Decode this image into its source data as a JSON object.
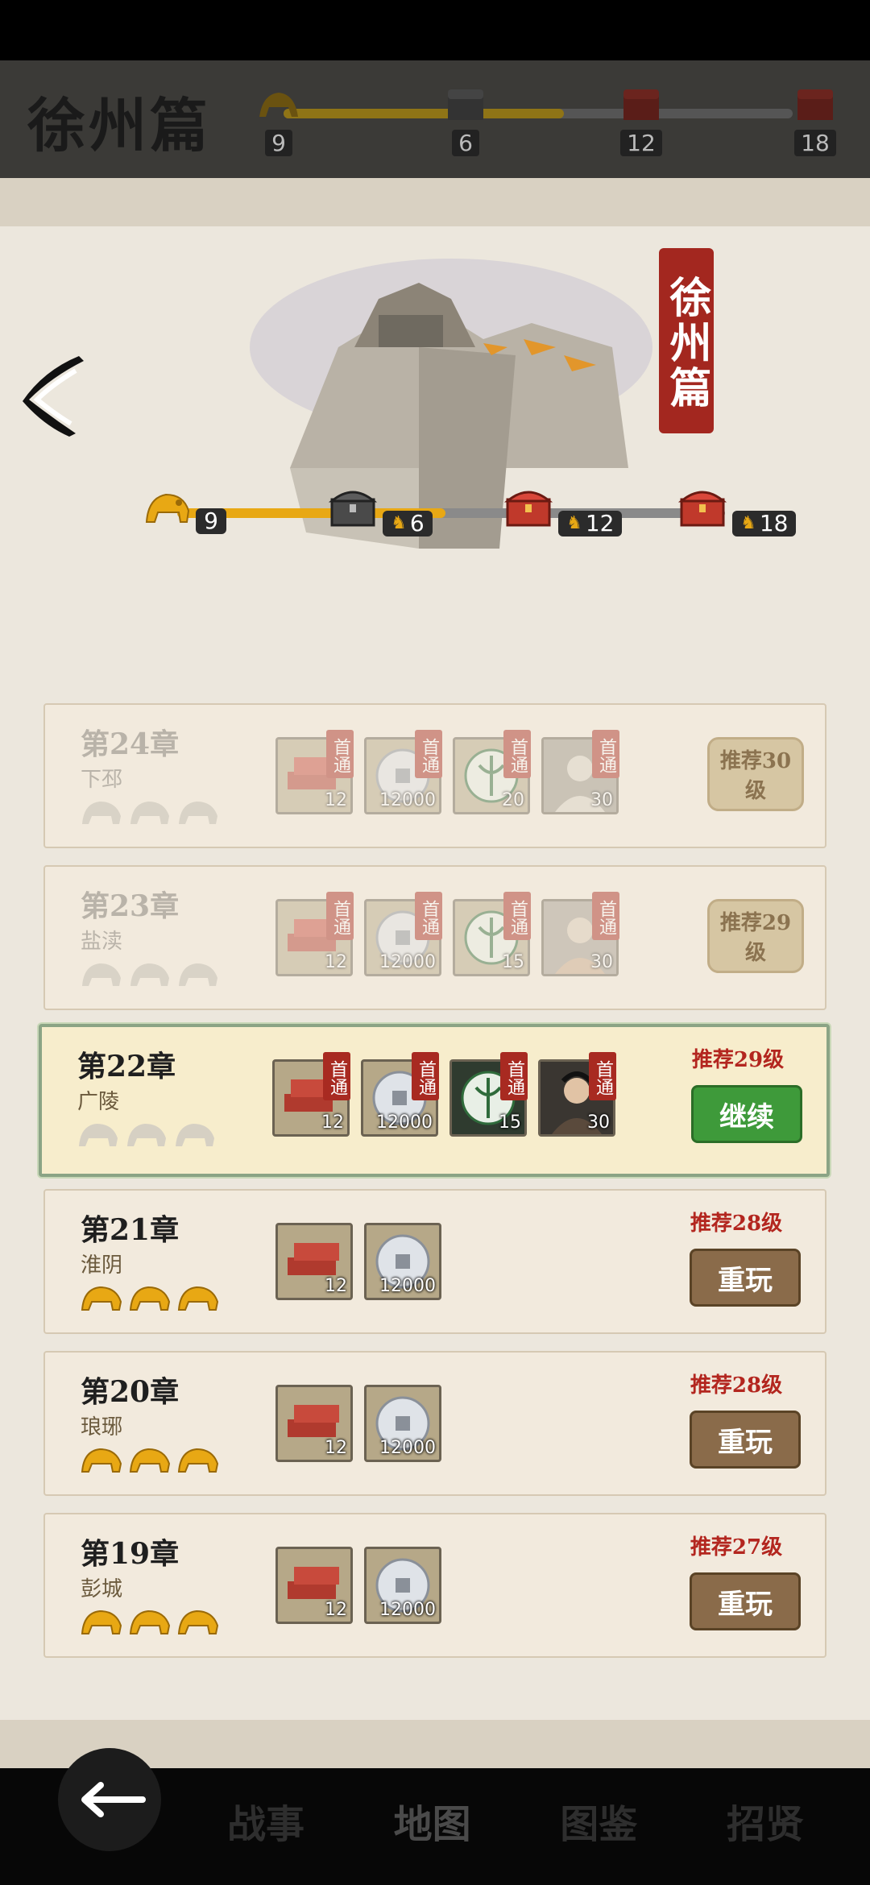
{
  "top_banner": {
    "title": "徐州篇",
    "nodes": [
      {
        "value": "9",
        "icon": "beast-icon"
      },
      {
        "value": "6",
        "icon": "chest-icon"
      },
      {
        "value": "12",
        "icon": "chest-icon"
      },
      {
        "value": "18",
        "icon": "chest-icon"
      }
    ]
  },
  "header": {
    "seal_text": "徐州篇",
    "back_icon": "chevron-left-icon",
    "progress": {
      "fraction": 0.49,
      "milestones": [
        {
          "value": "9",
          "icon": "beast-icon"
        },
        {
          "value": "6",
          "icon": "iron-chest-icon"
        },
        {
          "value": "12",
          "icon": "red-chest-icon"
        },
        {
          "value": "18",
          "icon": "red-chest-icon"
        }
      ]
    }
  },
  "chapters": [
    {
      "title": "第24章",
      "place": "下邳",
      "state": "locked",
      "stars": 0,
      "rewards": [
        {
          "type": "brick",
          "amount": "12",
          "tag": "首通"
        },
        {
          "type": "coin",
          "amount": "12000",
          "tag": "首通"
        },
        {
          "type": "token",
          "amount": "20",
          "tag": "首通"
        },
        {
          "type": "hero",
          "amount": "30",
          "tag": "首通"
        }
      ],
      "lock_label": "推荐30级"
    },
    {
      "title": "第23章",
      "place": "盐渎",
      "state": "locked",
      "stars": 0,
      "rewards": [
        {
          "type": "brick",
          "amount": "12",
          "tag": "首通"
        },
        {
          "type": "coin",
          "amount": "12000",
          "tag": "首通"
        },
        {
          "type": "token",
          "amount": "15",
          "tag": "首通"
        },
        {
          "type": "hero",
          "amount": "30",
          "tag": "首通"
        }
      ],
      "lock_label": "推荐29级"
    },
    {
      "title": "第22章",
      "place": "广陵",
      "state": "active",
      "stars": 0,
      "rewards": [
        {
          "type": "brick",
          "amount": "12",
          "tag": "首通"
        },
        {
          "type": "coin",
          "amount": "12000",
          "tag": "首通"
        },
        {
          "type": "token",
          "amount": "15",
          "tag": "首通"
        },
        {
          "type": "hero",
          "amount": "30",
          "tag": "首通"
        }
      ],
      "recommend": "推荐29级",
      "button": "继续"
    },
    {
      "title": "第21章",
      "place": "淮阴",
      "state": "done",
      "stars": 3,
      "rewards": [
        {
          "type": "brick",
          "amount": "12"
        },
        {
          "type": "coin",
          "amount": "12000"
        }
      ],
      "recommend": "推荐28级",
      "button": "重玩"
    },
    {
      "title": "第20章",
      "place": "琅琊",
      "state": "done",
      "stars": 3,
      "rewards": [
        {
          "type": "brick",
          "amount": "12"
        },
        {
          "type": "coin",
          "amount": "12000"
        }
      ],
      "recommend": "推荐28级",
      "button": "重玩"
    },
    {
      "title": "第19章",
      "place": "彭城",
      "state": "done",
      "stars": 3,
      "rewards": [
        {
          "type": "brick",
          "amount": "12"
        },
        {
          "type": "coin",
          "amount": "12000"
        }
      ],
      "recommend": "推荐27级",
      "button": "重玩"
    }
  ],
  "bottom_nav": {
    "back_icon": "arrow-left-icon",
    "tabs": [
      {
        "label": "战事",
        "active": false
      },
      {
        "label": "地图",
        "active": true
      },
      {
        "label": "图鉴",
        "active": false
      },
      {
        "label": "招贤",
        "active": false
      }
    ]
  },
  "colors": {
    "accent_red": "#a3271f",
    "progress_gold": "#e8a814",
    "continue_green": "#3e9a3a",
    "replay_brown": "#8a6b4a",
    "paper": "#ece7dd"
  }
}
